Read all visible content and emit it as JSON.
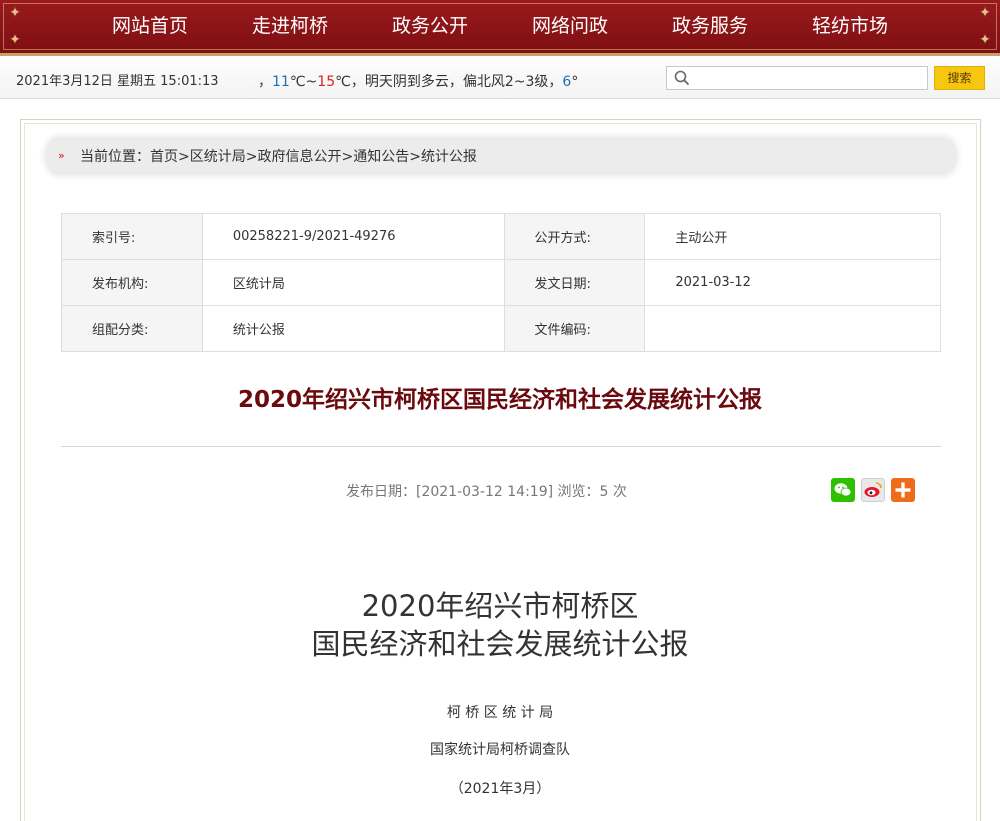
{
  "nav": {
    "items": [
      "网站首页",
      "走进柯桥",
      "政务公开",
      "网络问政",
      "政务服务",
      "轻纺市场"
    ]
  },
  "infobar": {
    "datetime": "2021年3月12日 星期五 15:01:13",
    "weather_prefix": "，",
    "temp_low": "11",
    "temp_sep": "℃~",
    "temp_high": "15",
    "weather_desc": "℃，明天阴到多云，偏北风2~3级，",
    "aqi": "6",
    "aqi_suffix": "°",
    "search_placeholder": "",
    "search_button": "搜索"
  },
  "breadcrumb": {
    "label": "当前位置：",
    "items": [
      "首页",
      "区统计局",
      "政府信息公开",
      "通知公告",
      "统计公报"
    ],
    "separator": ">"
  },
  "meta": {
    "rows": [
      {
        "l1": "索引号:",
        "v1": "00258221-9/2021-49276",
        "l2": "公开方式:",
        "v2": "主动公开"
      },
      {
        "l1": "发布机构:",
        "v1": "区统计局",
        "l2": "发文日期:",
        "v2": "2021-03-12"
      },
      {
        "l1": "组配分类:",
        "v1": "统计公报",
        "l2": "文件编码:",
        "v2": ""
      }
    ]
  },
  "document": {
    "title": "2020年绍兴市柯桥区国民经济和社会发展统计公报",
    "pub_info": "发布日期：[2021-03-12 14:19] 浏览：5 次",
    "body_title_line1": "2020年绍兴市柯桥区",
    "body_title_line2": "国民经济和社会发展统计公报",
    "author_1": "柯 桥 区 统 计 局",
    "author_2": "国家统计局柯桥调查队",
    "date": "（2021年3月）"
  },
  "colors": {
    "nav_bg": "#8a1418",
    "title_red": "#6b0a0e",
    "search_button": "#f7c610",
    "wechat": "#2dc100",
    "more": "#f06c1c"
  }
}
